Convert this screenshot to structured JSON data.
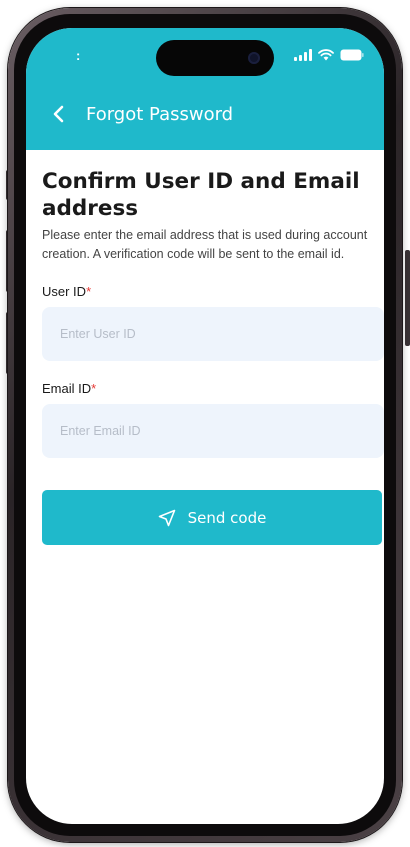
{
  "status_bar": {
    "time": ":",
    "icons": [
      "signal-icon",
      "wifi-icon",
      "battery-icon"
    ]
  },
  "header": {
    "back_icon": "chevron-left-icon",
    "title": "Forgot Password",
    "background_color": "#1fb9cb"
  },
  "main": {
    "heading": "Confirm User ID and Email address",
    "description": "Please enter the email address that is used during account creation. A verification code will be sent to the email id."
  },
  "form": {
    "user_id": {
      "label": "User ID",
      "required_marker": "*",
      "placeholder": "Enter User ID",
      "value": ""
    },
    "email_id": {
      "label": "Email ID",
      "required_marker": "*",
      "placeholder": "Enter Email ID",
      "value": ""
    },
    "send_button": {
      "label": "Send code",
      "icon": "send-icon"
    }
  },
  "colors": {
    "accent": "#1fb9cb",
    "required": "#e53935",
    "input_background": "#eef4fc"
  }
}
